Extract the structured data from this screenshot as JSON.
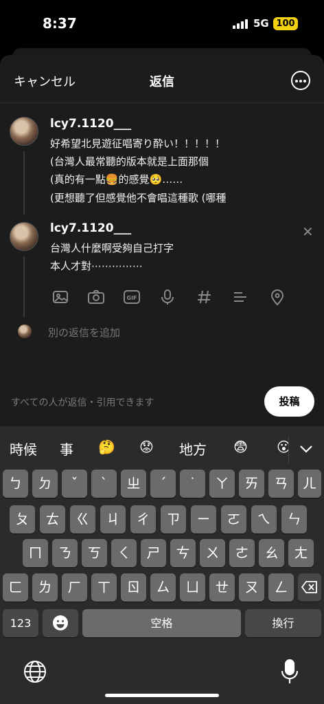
{
  "status_bar": {
    "time": "8:37",
    "network": "5G",
    "battery": "100"
  },
  "header": {
    "cancel_label": "キャンセル",
    "title": "返信"
  },
  "posts": [
    {
      "username": "lcy7.1120___",
      "lines": [
        "好希望北見遊征唱寄り酔い！！！！！",
        "(台灣人最常聽的版本就是上面那個",
        "(真的有一點🍔的感覺🥺……",
        "(更想聽了但感覺他不會唱這種歌 (哪種"
      ]
    },
    {
      "username": "lcy7.1120___",
      "lines": [
        "台灣人什麼啊受夠自己打字",
        "本人才對⋯⋯⋯⋯⋯"
      ]
    }
  ],
  "toolbar": {
    "icons": [
      "image-icon",
      "camera-icon",
      "gif-icon",
      "microphone-icon",
      "hashtag-icon",
      "list-icon",
      "location-icon"
    ]
  },
  "add_reply": {
    "label": "別の返信を追加"
  },
  "footer": {
    "permission_text": "すべての人が返信・引用できます",
    "post_button": "投稿"
  },
  "keyboard": {
    "candidates": [
      "時候",
      "事",
      "🤔",
      "😟",
      "地方",
      "😨",
      "😮"
    ],
    "row1": [
      "ㄅ",
      "ㄉ",
      "ˇ",
      "ˋ",
      "ㄓ",
      "ˊ",
      "˙",
      "ㄚ",
      "ㄞ",
      "ㄢ",
      "ㄦ"
    ],
    "row2": [
      "ㄆ",
      "ㄊ",
      "ㄍ",
      "ㄐ",
      "ㄔ",
      "ㄗ",
      "ㄧ",
      "ㄛ",
      "ㄟ",
      "ㄣ"
    ],
    "row3": [
      "ㄇ",
      "ㄋ",
      "ㄎ",
      "ㄑ",
      "ㄕ",
      "ㄘ",
      "ㄨ",
      "ㄜ",
      "ㄠ",
      "ㄤ"
    ],
    "row4": [
      "ㄈ",
      "ㄌ",
      "ㄏ",
      "ㄒ",
      "ㄖ",
      "ㄙ",
      "ㄩ",
      "ㄝ",
      "ㄡ",
      "ㄥ"
    ],
    "numbers_label": "123",
    "space_label": "空格",
    "return_label": "換行"
  }
}
